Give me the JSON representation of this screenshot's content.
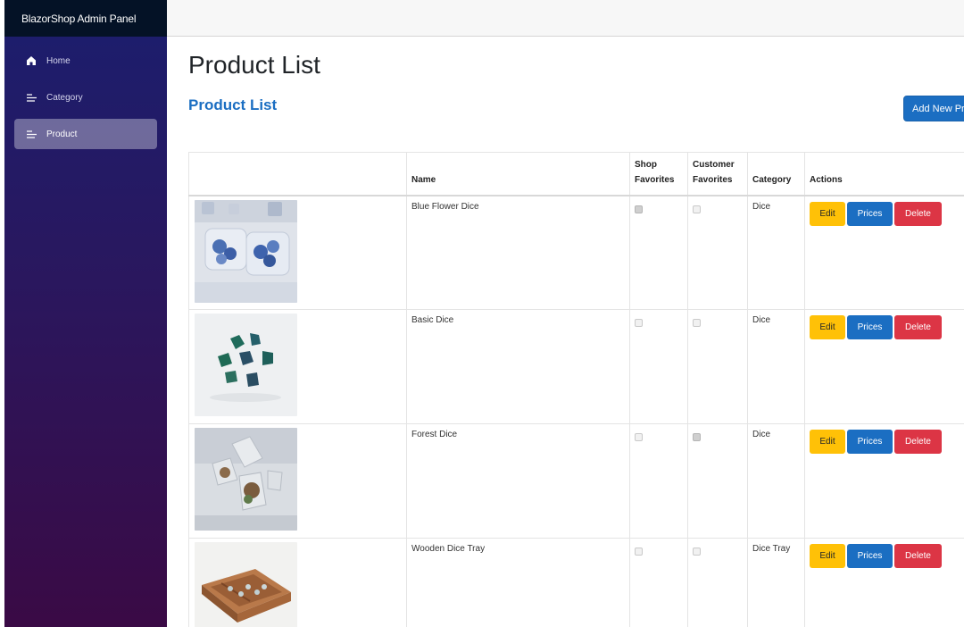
{
  "app": {
    "title": "BlazorShop Admin Panel"
  },
  "sidebar": {
    "items": [
      {
        "label": "Home",
        "icon": "home-icon",
        "active": false
      },
      {
        "label": "Category",
        "icon": "list-icon",
        "active": false
      },
      {
        "label": "Product",
        "icon": "list-icon",
        "active": true
      }
    ]
  },
  "page": {
    "title": "Product List",
    "section_title": "Product List",
    "add_button": "Add New Product"
  },
  "table": {
    "headers": {
      "image": "",
      "name": "Name",
      "shop_favorites_line1": "Shop",
      "shop_favorites_line2": "Favorites",
      "customer_favorites_line1": "Customer",
      "customer_favorites_line2": "Favorites",
      "category": "Category",
      "actions": "Actions"
    },
    "rows": [
      {
        "name": "Blue Flower Dice",
        "category": "Dice",
        "shop_favorite": true,
        "customer_favorite": false,
        "image": "blue flower resin dice"
      },
      {
        "name": "Basic Dice",
        "category": "Dice",
        "shop_favorite": false,
        "customer_favorite": false,
        "image": "green dice set"
      },
      {
        "name": "Forest Dice",
        "category": "Dice",
        "shop_favorite": false,
        "customer_favorite": true,
        "image": "forest resin dice"
      },
      {
        "name": "Wooden Dice Tray",
        "category": "Dice Tray",
        "shop_favorite": false,
        "customer_favorite": false,
        "image": "wooden dice tray"
      }
    ],
    "actions": {
      "edit": "Edit",
      "prices": "Prices",
      "delete": "Delete"
    }
  },
  "colors": {
    "primary": "#1b6ec2",
    "warning": "#ffc107",
    "danger": "#dc3545",
    "sidebar_top": "#1b1e6e",
    "sidebar_bottom": "#3a0a45",
    "brand_bar": "#041226"
  }
}
